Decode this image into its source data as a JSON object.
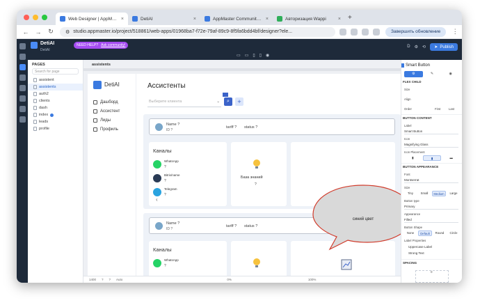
{
  "browser": {
    "tabs": [
      {
        "title": "Web Designer | AppMaster",
        "color": "#3b7ae0",
        "active": true
      },
      {
        "title": "DetiAI",
        "color": "#3b7ae0",
        "active": false
      },
      {
        "title": "AppMaster Community - The",
        "color": "#3b7ae0",
        "active": false
      },
      {
        "title": "Авторизация Wappi",
        "color": "#2fae5a",
        "active": false
      }
    ],
    "new_tab": "+",
    "url": "studio.appmaster.io/project/518861/web-apps/01968ba7-f72e-79af-89c9-8f5fa6bdd4bf/designer?ele...",
    "update_button": "Завершить обновление",
    "traffic_colors": [
      "#ff5f57",
      "#febc2e",
      "#28c840"
    ]
  },
  "topbar": {
    "project": "DetiAI",
    "project_sub": "DetiAI",
    "need_help": "NEED HELP?",
    "ask_community": "Ask community!",
    "avatar_letter": "D",
    "publish": "Publish"
  },
  "pages_panel": {
    "header": "PAGES",
    "search_placeholder": "Search for page",
    "items": [
      "assistent",
      "assistents",
      "auth2",
      "clients",
      "dash",
      "index",
      "leads",
      "profile"
    ],
    "active_index": 1
  },
  "canvas": {
    "breadcrumb": "assistents",
    "app_logo_text": "DetiAI",
    "menu": [
      "Дашборд",
      "Ассистент",
      "Лиды",
      "Профиль"
    ],
    "heading": "Ассистенты",
    "select_placeholder": "Выберите клиента",
    "cards": [
      {
        "name": "Name ?",
        "id": "ID ?",
        "tariff": "tariff ?",
        "status": "status ?",
        "channels_title": "Каналы",
        "channels": [
          {
            "name": "WhatsApp",
            "value": "?",
            "color": "#25d366"
          },
          {
            "name": "Bitrix/name",
            "value": "?",
            "color": "#2a3b55"
          },
          {
            "name": "Telegram",
            "value": "?",
            "color": "#2aa3df"
          }
        ],
        "kb_title": "База знаний",
        "kb_value": "?"
      },
      {
        "name": "Name ?",
        "id": "ID ?",
        "tariff": "tariff ?",
        "status": "status ?",
        "channels_title": "Каналы",
        "channels": [
          {
            "name": "WhatsApp",
            "value": "?",
            "color": "#25d366"
          }
        ]
      }
    ],
    "bubble_text": "синий цвет",
    "statusbar": [
      "1400",
      "?",
      "?",
      "Auto",
      "0%",
      "100%"
    ]
  },
  "right_panel": {
    "title": "Smart Button",
    "section_flex": "FLEX CHILD",
    "size_label": "Size",
    "align_label": "Align",
    "order_label": "Order",
    "order_opts": [
      "First",
      "Last"
    ],
    "section_content": "BUTTON CONTENT",
    "label_label": "Label",
    "label_value": "Smart Button",
    "icon_label": "Icon",
    "icon_value": "Magnifying Glass",
    "icon_placement": "Icon Placement",
    "section_appearance": "BUTTON APPEARANCE",
    "font_label": "Font",
    "font_value": "Montserrat",
    "size2_label": "Size",
    "size_opts": [
      "Tiny",
      "Small",
      "Medium",
      "Large"
    ],
    "size_active": 2,
    "btntype_label": "Button type",
    "btntype_value": "Primary",
    "appearance_label": "Appearance",
    "appearance_value": "Filled",
    "shape_label": "Button Shape",
    "shape_opts": [
      "None",
      "Default",
      "Round",
      "Circle"
    ],
    "shape_active": 1,
    "labelprops": "Label Properties",
    "uppercase": "Uppercase Label",
    "strong": "Strong Text",
    "section_spacing": "SPACING",
    "spacing_value": "0"
  }
}
